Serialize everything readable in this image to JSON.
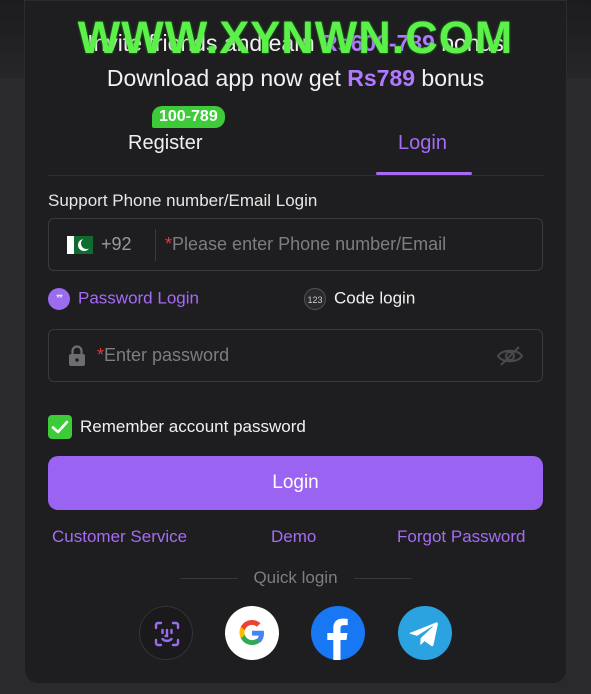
{
  "watermark": "WWW.XYNWN.COM",
  "promo": {
    "line1_prefix": "Invite friends and earn ",
    "line1_amount": "Rs600-789",
    "line1_suffix": " bonus",
    "line2_prefix": "Download app now get ",
    "line2_amount": "Rs789",
    "line2_suffix": " bonus"
  },
  "tabs": {
    "register_label": "Register",
    "register_badge": "100-789",
    "login_label": "Login",
    "active": "Login"
  },
  "form": {
    "section_label": "Support Phone number/Email Login",
    "country_code": "+92",
    "required_mark": "*",
    "phone_placeholder": "Please enter Phone number/Email",
    "password_placeholder": "Enter password",
    "modes": {
      "password_label": "Password Login",
      "password_icon_text": "**",
      "code_label": "Code login",
      "code_icon_text": "123"
    },
    "remember_label": "Remember account password",
    "remember_checked": true,
    "login_button": "Login"
  },
  "links": {
    "customer_service": "Customer Service",
    "demo": "Demo",
    "forgot_password": "Forgot Password"
  },
  "quick_login": {
    "label": "Quick login",
    "providers": [
      "face-id-icon",
      "google-icon",
      "facebook-icon",
      "telegram-icon"
    ]
  },
  "colors": {
    "accent": "#a56bf5",
    "button": "#9b63f2",
    "success": "#3dcb3a",
    "background": "#1e1e20"
  }
}
